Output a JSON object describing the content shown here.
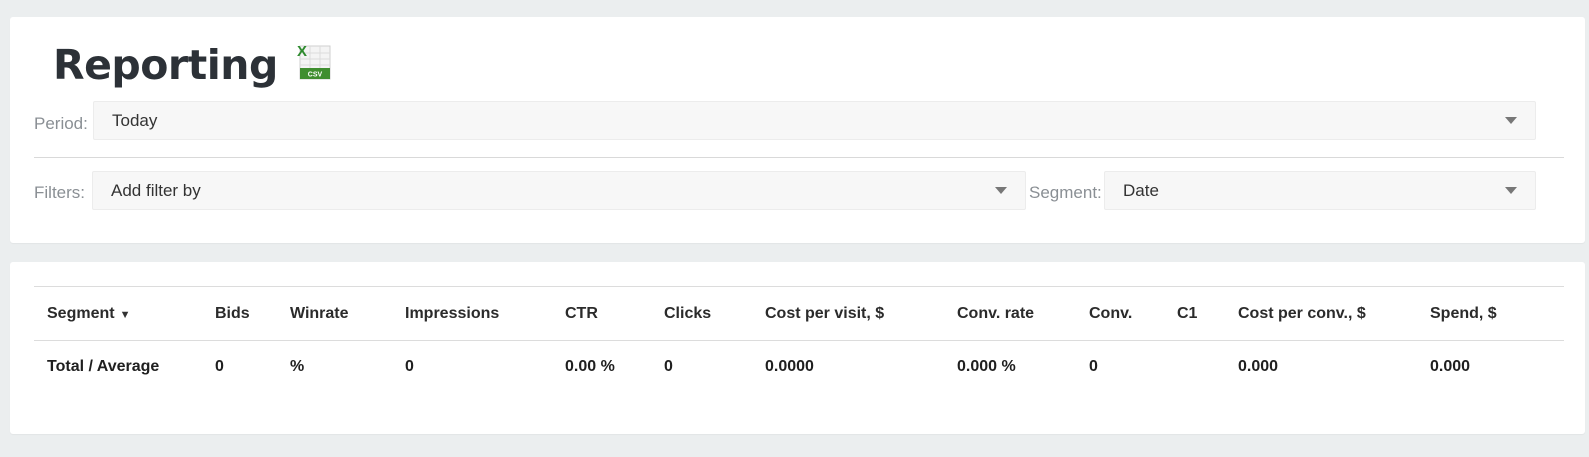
{
  "header": {
    "title": "Reporting",
    "csv_icon_text": "CSV",
    "csv_icon_letter": "X"
  },
  "period": {
    "label": "Period:",
    "value": "Today"
  },
  "filters": {
    "label": "Filters:",
    "placeholder": "Add filter by"
  },
  "segment": {
    "label": "Segment:",
    "value": "Date"
  },
  "table": {
    "sort_indicator": "▼",
    "columns": [
      "Segment",
      "Bids",
      "Winrate",
      "Impressions",
      "CTR",
      "Clicks",
      "Cost per visit, $",
      "Conv. rate",
      "Conv.",
      "C1",
      "Cost per conv., $",
      "Spend, $"
    ],
    "rows": [
      [
        "Total / Average",
        "0",
        "%",
        "0",
        "0.00 %",
        "0",
        "0.0000",
        "0.000 %",
        "0",
        "",
        "0.000",
        "0.000"
      ]
    ]
  },
  "colors": {
    "background": "#ebeeef",
    "card": "#ffffff",
    "title": "#2c3137",
    "excel_green": "#1e7a3a"
  }
}
